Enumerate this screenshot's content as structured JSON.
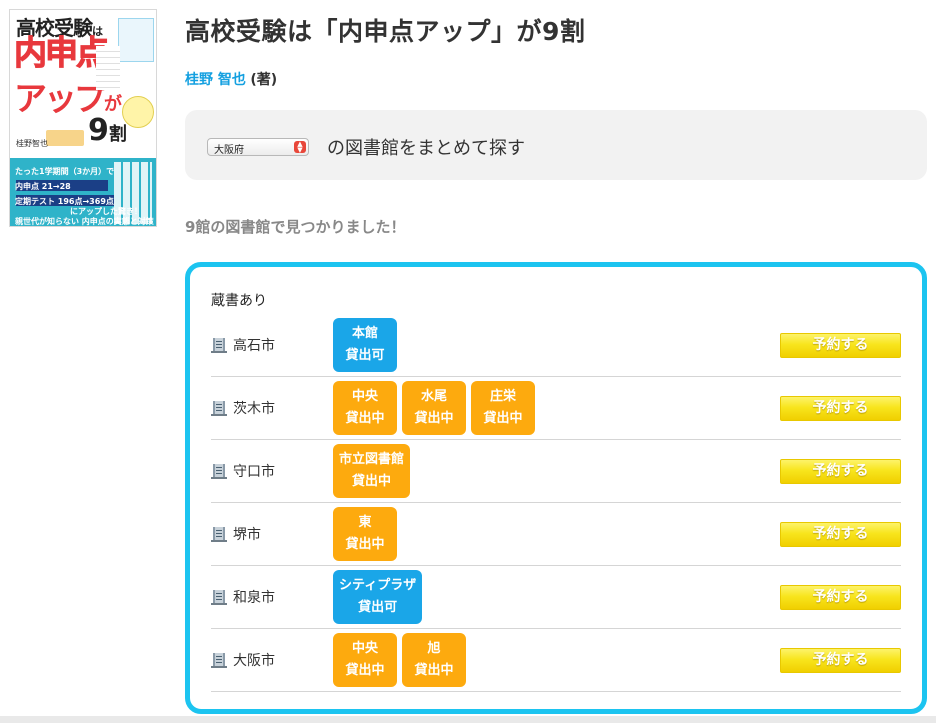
{
  "cover": {
    "title_line1": "高校受験",
    "title_line1_suffix": "は",
    "title_line2": "内申点",
    "title_line3": "アップ",
    "title_line3_suffix": "が",
    "title_line4": "9",
    "title_line4_suffix": "割",
    "author": "桂野智也",
    "line1": "たった1学期間（3か月）で",
    "line2": "内申点 21→28",
    "line3": "定期テスト 196点→369点",
    "line4": "にアップした驚き！",
    "line5": "親世代が知らない 内申点の実態と対策 とは"
  },
  "book": {
    "title": "高校受験は「内申点アップ」が9割",
    "author": "桂野 智也",
    "author_role": "(著)"
  },
  "search": {
    "prefecture": "大阪府",
    "label": "の図書館をまとめて探す"
  },
  "result": {
    "found_text": "9館の図書館で見つかりました！",
    "section_label": "蔵書あり",
    "reserve_label": "予約する",
    "rows": [
      {
        "city": "高石市",
        "badges": [
          {
            "name": "本館",
            "status": "貸出可",
            "color": "blue"
          }
        ]
      },
      {
        "city": "茨木市",
        "badges": [
          {
            "name": "中央",
            "status": "貸出中",
            "color": "orange"
          },
          {
            "name": "水尾",
            "status": "貸出中",
            "color": "orange"
          },
          {
            "name": "庄栄",
            "status": "貸出中",
            "color": "orange"
          }
        ]
      },
      {
        "city": "守口市",
        "badges": [
          {
            "name": "市立図書館",
            "status": "貸出中",
            "color": "orange"
          }
        ]
      },
      {
        "city": "堺市",
        "badges": [
          {
            "name": "東",
            "status": "貸出中",
            "color": "orange"
          }
        ]
      },
      {
        "city": "和泉市",
        "badges": [
          {
            "name": "シティプラザ",
            "status": "貸出可",
            "color": "blue"
          }
        ]
      },
      {
        "city": "大阪市",
        "badges": [
          {
            "name": "中央",
            "status": "貸出中",
            "color": "orange"
          },
          {
            "name": "旭",
            "status": "貸出中",
            "color": "orange"
          }
        ]
      }
    ]
  },
  "colors": {
    "accent": "#1cc4f0",
    "available": "#1aa6e8",
    "lent": "#fdaa0e",
    "reserve": "#f8e51d",
    "link": "#14a0e0"
  }
}
